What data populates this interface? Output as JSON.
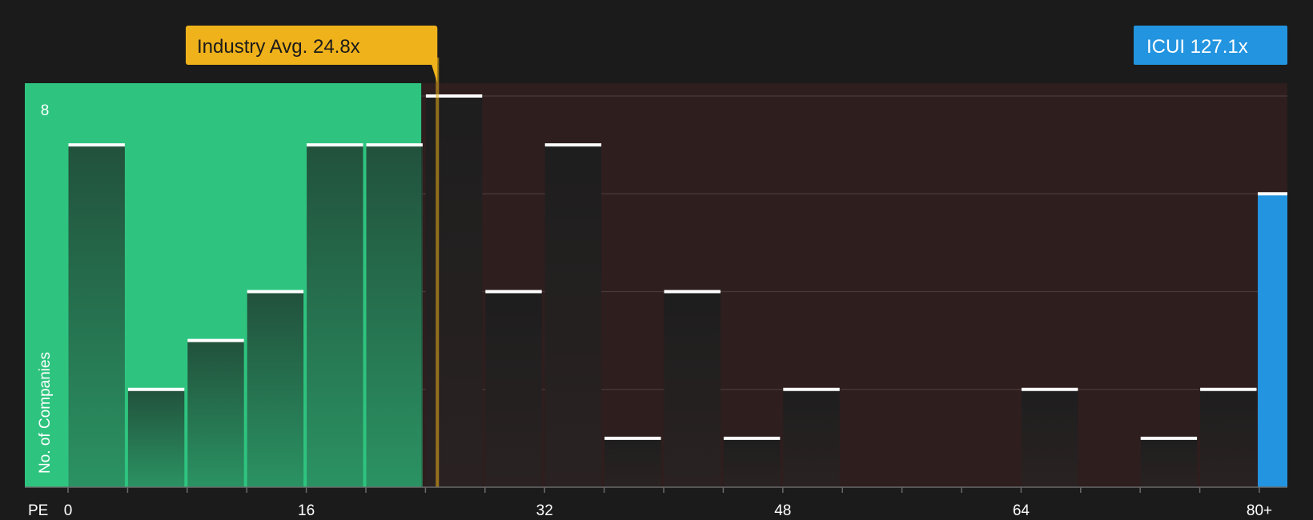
{
  "chart_data": {
    "type": "bar",
    "x_axis_label": "PE",
    "y_axis_label": "No. of Companies",
    "x_ticks": [
      "0",
      "16",
      "32",
      "48",
      "64",
      "80+"
    ],
    "y_tick": "8",
    "ylim": [
      0,
      8
    ],
    "bin_width": 4,
    "bins": [
      {
        "x": 0,
        "count": 7
      },
      {
        "x": 4,
        "count": 2
      },
      {
        "x": 8,
        "count": 3
      },
      {
        "x": 12,
        "count": 4
      },
      {
        "x": 16,
        "count": 7
      },
      {
        "x": 20,
        "count": 7
      },
      {
        "x": 24,
        "count": 8
      },
      {
        "x": 28,
        "count": 4
      },
      {
        "x": 32,
        "count": 7
      },
      {
        "x": 36,
        "count": 1
      },
      {
        "x": 40,
        "count": 4
      },
      {
        "x": 44,
        "count": 1
      },
      {
        "x": 48,
        "count": 2
      },
      {
        "x": 64,
        "count": 2
      },
      {
        "x": 72,
        "count": 1
      },
      {
        "x": 76,
        "count": 2
      }
    ],
    "highlight_bar": {
      "label": "ICUI 127.1x",
      "count": 6,
      "value": 127.1
    },
    "industry_avg": {
      "label": "Industry Avg. 24.8x",
      "value": 24.8
    },
    "colors": {
      "background": "#1b1b1b",
      "undervalued_zone": "#2ec47f",
      "overvalued_zone": "#2e1e1e",
      "callout": "#f0b21b",
      "highlight": "#2394e0"
    }
  }
}
